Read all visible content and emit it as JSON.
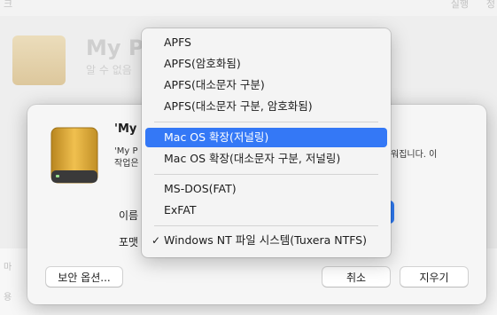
{
  "background": {
    "top_left": "크",
    "top_right_1": "실행",
    "top_right_2": "정",
    "title": "My Pa",
    "subtitle": "알 수 없음",
    "row_label_1": "마",
    "row_label_2": "용"
  },
  "dialog": {
    "title": "'My I",
    "description": "'My P\n작업은",
    "description_tail": "워집니다. 이",
    "name_label": "이름",
    "format_label": "포맷",
    "security_button": "보안 옵션...",
    "cancel_button": "취소",
    "erase_button": "지우기"
  },
  "format_menu": {
    "items": [
      {
        "label": "APFS"
      },
      {
        "label": "APFS(암호화됨)"
      },
      {
        "label": "APFS(대소문자 구분)"
      },
      {
        "label": "APFS(대소문자 구분, 암호화됨)"
      },
      {
        "label": "Mac OS 확장(저널링)",
        "highlighted": true
      },
      {
        "label": "Mac OS 확장(대소문자 구분, 저널링)"
      },
      {
        "label": "MS-DOS(FAT)"
      },
      {
        "label": "ExFAT"
      },
      {
        "label": "Windows NT 파일 시스템(Tuxera NTFS)",
        "checked": true
      }
    ],
    "check_glyph": "✓"
  },
  "colors": {
    "highlight": "#3478f6",
    "drive_gold": "#d8a83a"
  }
}
